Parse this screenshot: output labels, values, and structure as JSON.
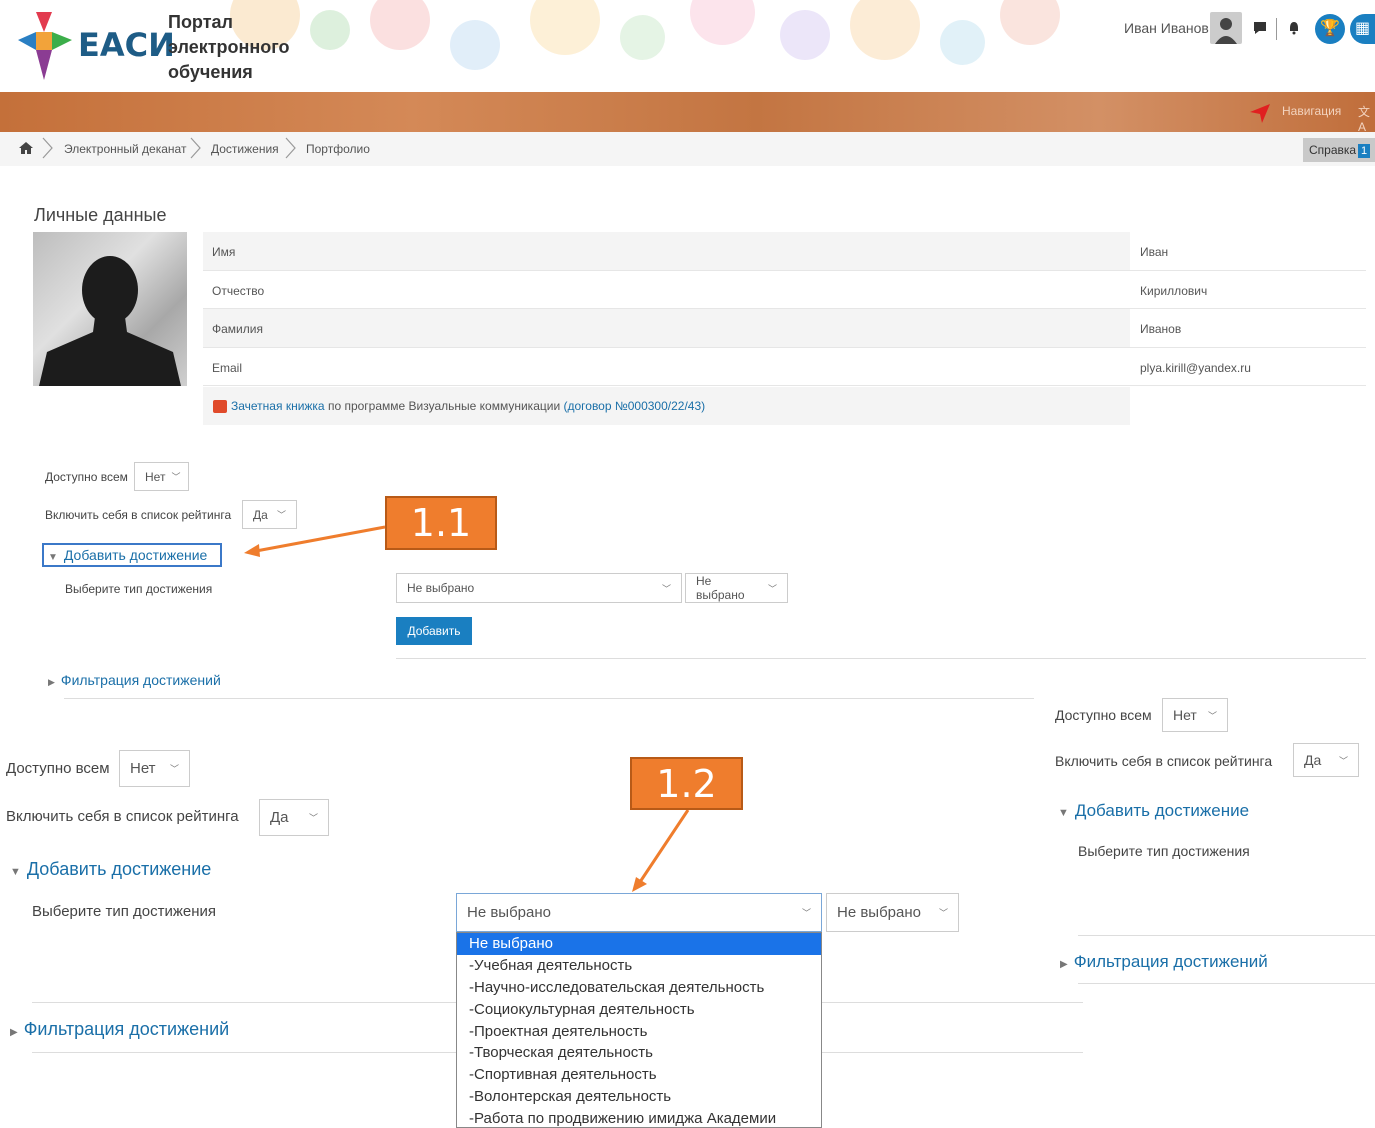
{
  "header": {
    "logo_text": "ЕАСИ",
    "portal_title": "Портал электронного обучения",
    "user_name": "Иван Иванов",
    "nav_label": "Навигация"
  },
  "breadcrumb": {
    "items": [
      "Электронный деканат",
      "Достижения",
      "Портфолио"
    ],
    "help_label": "Справка",
    "help_badge": "1"
  },
  "personal": {
    "title": "Личные данные",
    "rows": [
      {
        "label": "Имя",
        "value": "Иван"
      },
      {
        "label": "Отчество",
        "value": "Кириллович"
      },
      {
        "label": "Фамилия",
        "value": "Иванов"
      },
      {
        "label": "Email",
        "value": "plya.kirill@yandex.ru"
      }
    ],
    "record_link": "Зачетная книжка",
    "record_text": " по программе Визуальные коммуникации ",
    "record_contract": "(договор №000300/22/43)"
  },
  "form": {
    "available_label": "Доступно всем",
    "available_value": "Нет",
    "rating_label": "Включить себя в список рейтинга",
    "rating_value": "Да",
    "add_achievement": "Добавить достижение",
    "select_type_label": "Выберите тип достижения",
    "type_value": "Не выбрано",
    "subtype_value": "Не выбрано",
    "add_button": "Добавить",
    "filter_label": "Фильтрация достижений"
  },
  "callouts": {
    "c1": "1.1",
    "c2": "1.2"
  },
  "dropdown": {
    "options": [
      "Не выбрано",
      "-Учебная деятельность",
      "-Научно-исследовательская деятельность",
      "-Социокультурная деятельность",
      "-Проектная деятельность",
      "-Творческая деятельность",
      "-Спортивная деятельность",
      "-Волонтерская деятельность",
      "-Работа по продвижению имиджа Академии"
    ]
  },
  "colors": {
    "accent": "#1a7fc1",
    "callout": "#ef7d2d",
    "band": "#c4703a"
  }
}
